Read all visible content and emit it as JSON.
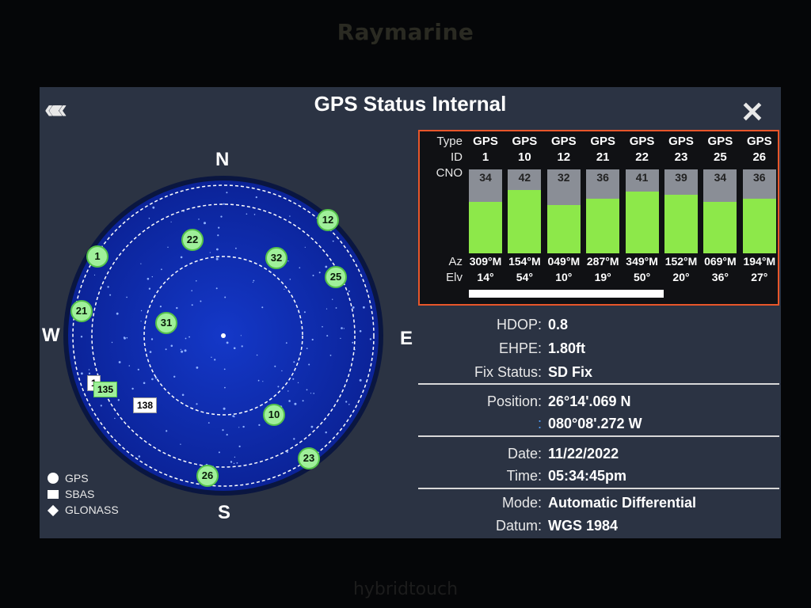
{
  "device": {
    "brand": "Raymarine",
    "footer_brand": "hybridtouch"
  },
  "header": {
    "title": "GPS Status Internal",
    "back_icon": "triple-chevron-left-icon",
    "close_icon": "close-x-icon",
    "back_glyph": "«««",
    "close_glyph": "✕"
  },
  "compass": {
    "n": "N",
    "s": "S",
    "e": "E",
    "w": "W"
  },
  "sky_satellites": [
    {
      "id": "1",
      "type": "gps",
      "az": 309,
      "elv": 14
    },
    {
      "id": "10",
      "type": "gps",
      "az": 154,
      "elv": 54
    },
    {
      "id": "12",
      "type": "gps",
      "az": 49,
      "elv": 10
    },
    {
      "id": "21",
      "type": "gps",
      "az": 287,
      "elv": 19
    },
    {
      "id": "22",
      "type": "gps",
      "az": 349,
      "elv": 50
    },
    {
      "id": "23",
      "type": "gps",
      "az": 152,
      "elv": 20
    },
    {
      "id": "25",
      "type": "gps",
      "az": 69,
      "elv": 36
    },
    {
      "id": "26",
      "type": "gps",
      "az": 194,
      "elv": 27
    },
    {
      "id": "31",
      "type": "gps"
    },
    {
      "id": "32",
      "type": "gps"
    },
    {
      "id": "1",
      "type": "sbas"
    },
    {
      "id": "135",
      "type": "sbas"
    },
    {
      "id": "138",
      "type": "sbas"
    }
  ],
  "legend": {
    "gps": "GPS",
    "sbas": "SBAS",
    "glonass": "GLONASS"
  },
  "cno_table": {
    "row_labels": {
      "type": "Type",
      "id": "ID",
      "cno": "CNO",
      "az": "Az",
      "elv": "Elv"
    },
    "cno_max": 50,
    "satellites": [
      {
        "type": "GPS",
        "id": "1",
        "cno": 34,
        "cno_text": "34",
        "az": "309°M",
        "elv": "14°"
      },
      {
        "type": "GPS",
        "id": "10",
        "cno": 42,
        "cno_text": "42",
        "az": "154°M",
        "elv": "54°"
      },
      {
        "type": "GPS",
        "id": "12",
        "cno": 32,
        "cno_text": "32",
        "az": "049°M",
        "elv": "10°"
      },
      {
        "type": "GPS",
        "id": "21",
        "cno": 36,
        "cno_text": "36",
        "az": "287°M",
        "elv": "19°"
      },
      {
        "type": "GPS",
        "id": "22",
        "cno": 41,
        "cno_text": "41",
        "az": "349°M",
        "elv": "50°"
      },
      {
        "type": "GPS",
        "id": "23",
        "cno": 39,
        "cno_text": "39",
        "az": "152°M",
        "elv": "20°"
      },
      {
        "type": "GPS",
        "id": "25",
        "cno": 34,
        "cno_text": "34",
        "az": "069°M",
        "elv": "36°"
      },
      {
        "type": "GPS",
        "id": "26",
        "cno": 36,
        "cno_text": "36",
        "az": "194°M",
        "elv": "27°"
      }
    ]
  },
  "info": {
    "hdop_label": "HDOP:",
    "hdop": "0.8",
    "ehpe_label": "EHPE:",
    "ehpe": "1.80ft",
    "fix_label": "Fix Status:",
    "fix": "SD Fix",
    "position_label": "Position:",
    "lat": "26°14'.069 N",
    "lon_label": ":",
    "lon": "080°08'.272 W",
    "date_label": "Date:",
    "date": "11/22/2022",
    "time_label": "Time:",
    "time": "05:34:45pm",
    "mode_label": "Mode:",
    "mode": "Automatic Differential",
    "datum_label": "Datum:",
    "datum": "WGS 1984"
  },
  "colors": {
    "panel_bg": "#2b3343",
    "sky_blue": "#0f2fb8",
    "bar_green": "#8de84a",
    "sat_green": "#9ff09a",
    "panel_border": "#e8562a"
  }
}
